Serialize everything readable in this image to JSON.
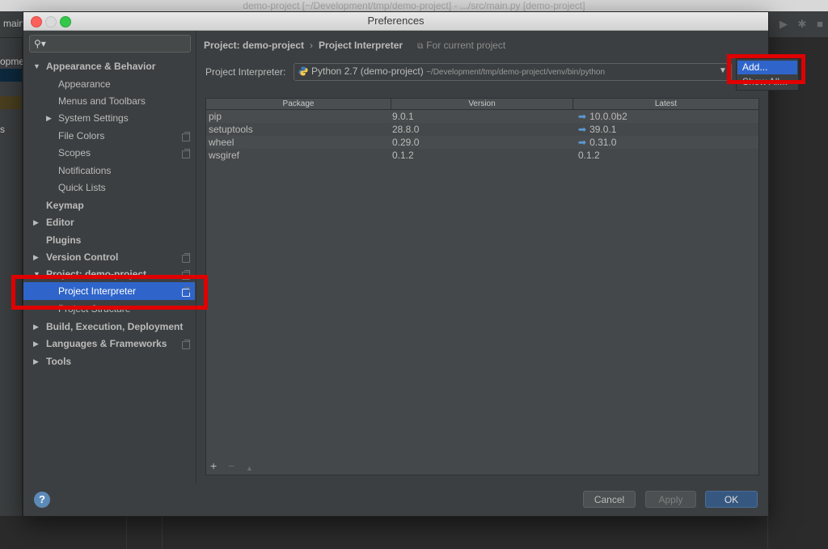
{
  "ide": {
    "window_title": "demo-project [~/Development/tmp/demo-project] - .../src/main.py [demo-project]",
    "toolbar_label": "main",
    "left_project_fragment": "opme",
    "left_s_fragment": "s"
  },
  "dialog": {
    "title": "Preferences"
  },
  "search": {
    "placeholder": "",
    "icon": "search-icon"
  },
  "tree": {
    "appearance_behavior": "Appearance & Behavior",
    "appearance": "Appearance",
    "menus_toolbars": "Menus and Toolbars",
    "system_settings": "System Settings",
    "file_colors": "File Colors",
    "scopes": "Scopes",
    "notifications": "Notifications",
    "quick_lists": "Quick Lists",
    "keymap": "Keymap",
    "editor": "Editor",
    "plugins": "Plugins",
    "version_control": "Version Control",
    "project": "Project: demo-project",
    "project_interpreter": "Project Interpreter",
    "project_structure": "Project Structure",
    "build": "Build, Execution, Deployment",
    "languages": "Languages & Frameworks",
    "tools": "Tools"
  },
  "breadcrumb": {
    "project": "Project: demo-project",
    "separator": "›",
    "page": "Project Interpreter",
    "scope": "For current project"
  },
  "interpreter": {
    "label": "Project Interpreter:",
    "name": "Python 2.7 (demo-project)",
    "path": "~/Development/tmp/demo-project/venv/bin/python"
  },
  "popup": {
    "add": "Add...",
    "show_all": "Show All..."
  },
  "table": {
    "headers": [
      "Package",
      "Version",
      "Latest"
    ],
    "rows": [
      {
        "package": "pip",
        "version": "9.0.1",
        "latest": "10.0.0b2",
        "upgrade": true
      },
      {
        "package": "setuptools",
        "version": "28.8.0",
        "latest": "39.0.1",
        "upgrade": true
      },
      {
        "package": "wheel",
        "version": "0.29.0",
        "latest": "0.31.0",
        "upgrade": true
      },
      {
        "package": "wsgiref",
        "version": "0.1.2",
        "latest": "0.1.2",
        "upgrade": false
      }
    ],
    "add_symbol": "+",
    "remove_symbol": "−",
    "upgrade_symbol": "▲"
  },
  "footer": {
    "help": "?",
    "cancel": "Cancel",
    "apply": "Apply",
    "ok": "OK"
  },
  "colors": {
    "selection": "#2f65ca",
    "highlight_annotation": "#e00000",
    "upgrade_arrow": "#5b9bd5"
  }
}
